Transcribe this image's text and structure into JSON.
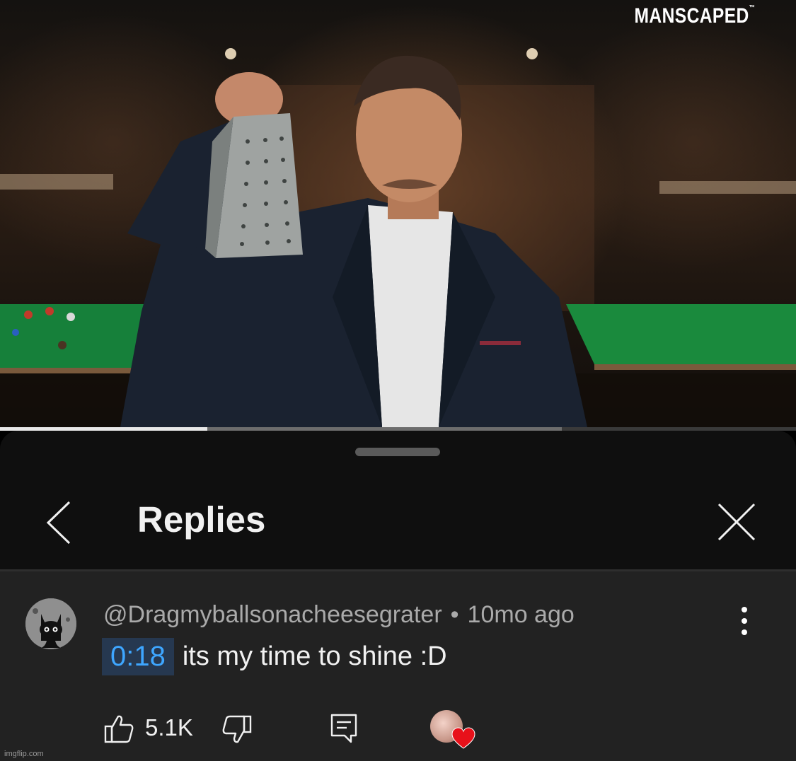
{
  "video": {
    "brand": "MANSCAPED",
    "brand_mark": "™",
    "progress": {
      "played_fraction": 0.26,
      "buffered_fraction": 0.706
    }
  },
  "sheet": {
    "title": "Replies",
    "back_icon": "chevron-left-icon",
    "close_icon": "close-icon"
  },
  "comment": {
    "author": "@Dragmyballsonacheesegrater",
    "separator": "•",
    "time_ago": "10mo ago",
    "timestamp_link": "0:18",
    "text": "its my time to shine :D",
    "like_count": "5.1K",
    "icons": {
      "like": "thumbs-up-icon",
      "dislike": "thumbs-down-icon",
      "reply": "reply-icon",
      "more": "more-vert-icon",
      "creator_heart": "heart-icon"
    },
    "colors": {
      "timestamp_text": "#3ea6ff",
      "heart": "#e8111a"
    }
  },
  "watermark": "imgflip.com"
}
